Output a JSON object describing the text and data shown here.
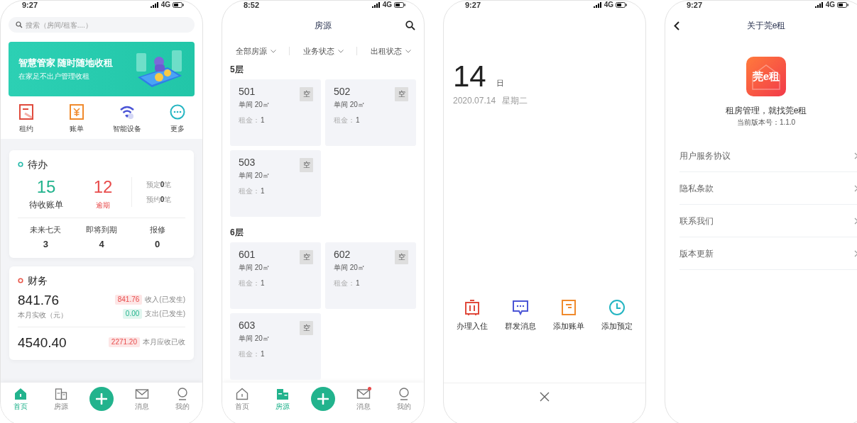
{
  "phones": [
    {
      "kind": "home",
      "status": {
        "time": "9:27",
        "network": "4G"
      },
      "search": {
        "placeholder": "搜索（房间/租客....）"
      },
      "banner": {
        "title": "智慧管家 随时随地收租",
        "subtitle": "在家足不出户管理收租"
      },
      "shortcuts": [
        {
          "label": "租约"
        },
        {
          "label": "账单"
        },
        {
          "label": "智能设备"
        },
        {
          "label": "更多"
        }
      ],
      "todo": {
        "title": "待办",
        "pending": {
          "count": "15",
          "label": "待收账单"
        },
        "overdue": {
          "count": "12",
          "label": "逾期"
        },
        "notes": [
          "预定**0**笔",
          "预约**0**笔"
        ],
        "stats": [
          {
            "label": "未来七天",
            "value": "3"
          },
          {
            "label": "即将到期",
            "value": "4"
          },
          {
            "label": "报修",
            "value": "0"
          }
        ]
      },
      "finance": {
        "title": "财务",
        "rows": [
          {
            "amount": "841.76",
            "caption": "本月实收（元）",
            "entries": [
              {
                "kind": "income",
                "value": "841.76",
                "label": "收入(已发生)"
              },
              {
                "kind": "expense",
                "value": "0.00",
                "label": "支出(已发生)"
              }
            ]
          },
          {
            "amount": "4540.40",
            "entries": [
              {
                "kind": "income",
                "value": "2271.20",
                "label": "本月应收已收"
              }
            ]
          }
        ]
      },
      "tab_bar": [
        {
          "kind": "tab",
          "label": "首页",
          "selected": true,
          "badge": false
        },
        {
          "kind": "tab",
          "label": "房源",
          "selected": false,
          "badge": false
        },
        {
          "kind": "add"
        },
        {
          "kind": "tab",
          "label": "消息",
          "selected": false,
          "badge": false
        },
        {
          "kind": "tab",
          "label": "我的",
          "selected": false,
          "badge": false
        }
      ]
    },
    {
      "kind": "rooms",
      "status": {
        "time": "8:52",
        "network": "4G"
      },
      "title": "房源",
      "filters": [
        {
          "label": "全部房源"
        },
        {
          "label": "业务状态"
        },
        {
          "label": "出租状态"
        }
      ],
      "floors": [
        {
          "label": "5层",
          "rooms": [
            {
              "number": "501",
              "type": "单间",
              "area": "20㎡",
              "rent_label": "租金：",
              "rent": "1",
              "status": "空"
            },
            {
              "number": "502",
              "type": "单间",
              "area": "20㎡",
              "rent_label": "租金：",
              "rent": "1",
              "status": "空"
            },
            {
              "number": "503",
              "type": "单间",
              "area": "20㎡",
              "rent_label": "租金：",
              "rent": "1",
              "status": "空"
            }
          ]
        },
        {
          "label": "6层",
          "rooms": [
            {
              "number": "601",
              "type": "单间",
              "area": "20㎡",
              "rent_label": "租金：",
              "rent": "1",
              "status": "空"
            },
            {
              "number": "602",
              "type": "单间",
              "area": "20㎡",
              "rent_label": "租金：",
              "rent": "1",
              "status": "空"
            },
            {
              "number": "603",
              "type": "单间",
              "area": "20㎡",
              "rent_label": "租金：",
              "rent": "1",
              "status": "空"
            }
          ]
        }
      ],
      "tab_bar": [
        {
          "kind": "tab",
          "label": "首页",
          "selected": false,
          "badge": false
        },
        {
          "kind": "tab",
          "label": "房源",
          "selected": true,
          "badge": false
        },
        {
          "kind": "add"
        },
        {
          "kind": "tab",
          "label": "消息",
          "selected": false,
          "badge": true
        },
        {
          "kind": "tab",
          "label": "我的",
          "selected": false,
          "badge": false
        }
      ]
    },
    {
      "kind": "quick",
      "status": {
        "time": "9:27",
        "network": "4G"
      },
      "day": "14",
      "day_unit": "日",
      "date": "2020.07.14",
      "weekday": "星期二",
      "actions": [
        {
          "label": "办理入住"
        },
        {
          "label": "群发消息"
        },
        {
          "label": "添加账单"
        },
        {
          "label": "添加预定"
        }
      ]
    },
    {
      "kind": "about",
      "status": {
        "time": "9:27",
        "network": "4G"
      },
      "title": "关于莞e租",
      "logo_text": "莞e租",
      "slogan": "租房管理，就找莞e租",
      "version": "当前版本号：1.1.0",
      "menu": [
        {
          "label": "用户服务协议"
        },
        {
          "label": "隐私条款"
        },
        {
          "label": "联系我们"
        },
        {
          "label": "版本更新"
        }
      ]
    }
  ]
}
